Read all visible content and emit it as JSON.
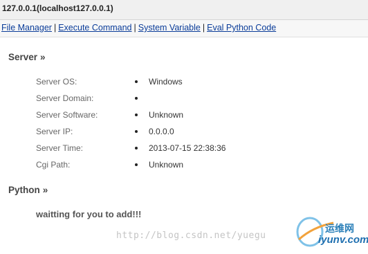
{
  "window": {
    "title": "127.0.0.1(localhost127.0.0.1)"
  },
  "nav": {
    "separator": "|",
    "links": [
      {
        "label": "File Manager"
      },
      {
        "label": "Execute Command"
      },
      {
        "label": "System Variable"
      },
      {
        "label": "Eval Python Code"
      }
    ]
  },
  "server": {
    "heading": "Server",
    "arrow": "»",
    "rows": [
      {
        "label": "Server OS:",
        "value": "Windows"
      },
      {
        "label": "Server Domain:",
        "value": ""
      },
      {
        "label": "Server Software:",
        "value": "Unknown"
      },
      {
        "label": "Server IP:",
        "value": "0.0.0.0"
      },
      {
        "label": "Server Time:",
        "value": "2013-07-15 22:38:36"
      },
      {
        "label": "Cgi Path:",
        "value": "Unknown"
      }
    ]
  },
  "python": {
    "heading": "Python",
    "arrow": "»",
    "message": "waitting for you to add!!!"
  },
  "watermark": {
    "url": "http://blog.csdn.net/yuegu",
    "logo_cn": "运维网",
    "logo_en": "iyunv.com",
    "logo_color": "#1e6fb0"
  }
}
